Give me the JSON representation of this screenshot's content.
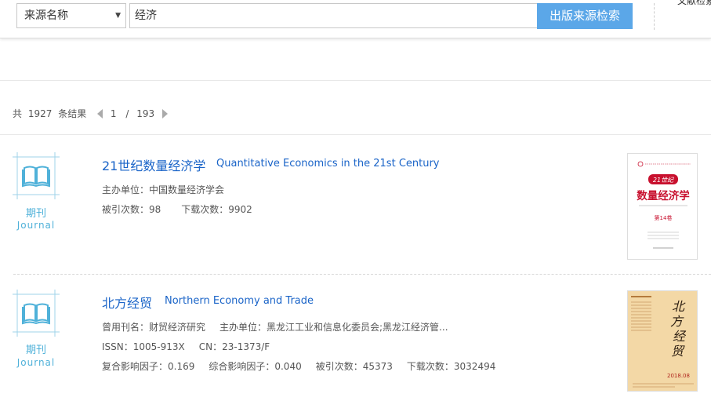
{
  "search": {
    "field_select": "来源名称",
    "query": "经济",
    "button": "出版来源检索",
    "side_link": "文献检索"
  },
  "pager": {
    "total_prefix": "共",
    "total": "1927",
    "total_suffix": "条结果",
    "current": "1",
    "separator": "/",
    "pages": "193"
  },
  "results": [
    {
      "type_cn": "期刊",
      "type_en": "Journal",
      "title_cn": "21世纪数量经济学",
      "title_en": "Quantitative Economics in the 21st Century",
      "host": "主办单位：中国数量经济学会",
      "cited": "被引次数：98",
      "downloads": "下载次数：9902",
      "cover": {
        "top_text": "中国数量经济学会",
        "badge": "21世纪",
        "big_title": "数量经济学",
        "en_line": "Quantitative Economics in the 21st Century",
        "volume": "第14卷"
      }
    },
    {
      "type_cn": "期刊",
      "type_en": "Journal",
      "title_cn": "北方经贸",
      "title_en": "Northern Economy and Trade",
      "former_name": "曾用刊名：财贸经济研究",
      "host": "主办单位：黑龙江工业和信息化委员会;黑龙江经济管...",
      "issn": "ISSN：1005-913X",
      "cn": "CN：23-1373/F",
      "impact_composite": "复合影响因子：0.169",
      "impact_comprehensive": "综合影响因子：0.040",
      "cited": "被引次数：45373",
      "downloads": "下载次数：3032494",
      "cover": {
        "calligraphy": "北方经贸",
        "issue": "2018.08"
      }
    }
  ],
  "colors": {
    "accent_button": "#5ba7e8",
    "title_link": "#1a64c8",
    "type_icon": "#4fb1d9",
    "cover2_bg": "#f3d8a6",
    "cover1_title": "#c8102e"
  }
}
